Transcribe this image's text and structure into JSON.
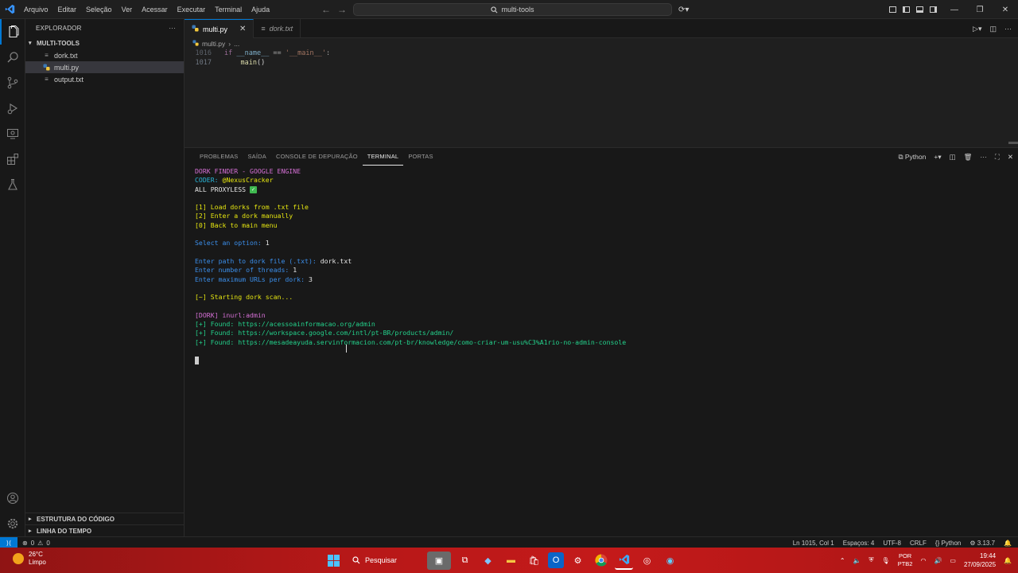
{
  "menu": [
    "Arquivo",
    "Editar",
    "Seleção",
    "Ver",
    "Acessar",
    "Executar",
    "Terminal",
    "Ajuda"
  ],
  "search": {
    "text": "multi-tools"
  },
  "sidebar": {
    "header": "EXPLORADOR",
    "folder": "MULTI-TOOLS",
    "files": [
      {
        "name": "dork.txt",
        "icon": "text-file-icon",
        "selected": false
      },
      {
        "name": "multi.py",
        "icon": "python-file-icon",
        "selected": true
      },
      {
        "name": "output.txt",
        "icon": "text-file-icon",
        "selected": false
      }
    ],
    "outline": "ESTRUTURA DO CÓDIGO",
    "timeline": "LINHA DO TEMPO"
  },
  "tabs": [
    {
      "label": "multi.py",
      "active": true
    },
    {
      "label": "dork.txt",
      "active": false
    }
  ],
  "breadcrumb": {
    "file": "multi.py",
    "rest": "..."
  },
  "editor": {
    "lines": [
      {
        "num": "1016",
        "kw": "if",
        "a": " __name__",
        "b": " == ",
        "c": "'__main__'",
        "d": ":"
      },
      {
        "num": "1017",
        "call": "main",
        "paren": "()"
      }
    ]
  },
  "panel": {
    "tabs": [
      "PROBLEMAS",
      "SAÍDA",
      "CONSOLE DE DEPURAÇÃO",
      "TERMINAL",
      "PORTAS"
    ],
    "active_tab": "TERMINAL",
    "shell": "Python"
  },
  "terminal": {
    "l1": "DORK FINDER - GOOGLE ENGINE",
    "l2a": "CODER: ",
    "l2b": "@NexusCracker",
    "l3": "ALL PROXYLESS ",
    "m1": "[1] Load dorks from .txt file",
    "m2": "[2] Enter a dork manually",
    "m3": "[0] Back to main menu",
    "p1a": "Select an option: ",
    "p1b": "1",
    "p2a": "Enter path to dork file (.txt): ",
    "p2b": "dork.txt",
    "p3a": "Enter number of threads: ",
    "p3b": "1",
    "p4a": "Enter maximum URLs per dork: ",
    "p4b": "3",
    "scan": "[~] Starting dork scan...",
    "dork": "[DORK] inurl:admin",
    "f1": "[+] Found: https://acessoainformacao.org/admin",
    "f2": "[+] Found: https://workspace.google.com/intl/pt-BR/products/admin/",
    "f3": "[+] Found: https://mesadeayuda.servinformacion.com/pt-br/knowledge/como-criar-um-usu%C3%A1rio-no-admin-console"
  },
  "status": {
    "errors": "0",
    "warnings": "0",
    "position": "Ln 1015, Col 1",
    "spaces": "Espaços: 4",
    "encoding": "UTF-8",
    "eol": "CRLF",
    "language": "Python",
    "version": "3.13.7"
  },
  "taskbar": {
    "temp": "26°C",
    "weather": "Limpo",
    "search": "Pesquisar",
    "lang1": "POR",
    "lang2": "PTB2",
    "time": "19:44",
    "date": "27/09/2025"
  },
  "colors": {
    "accent": "#0078d4",
    "taskbar": "#b71818"
  }
}
